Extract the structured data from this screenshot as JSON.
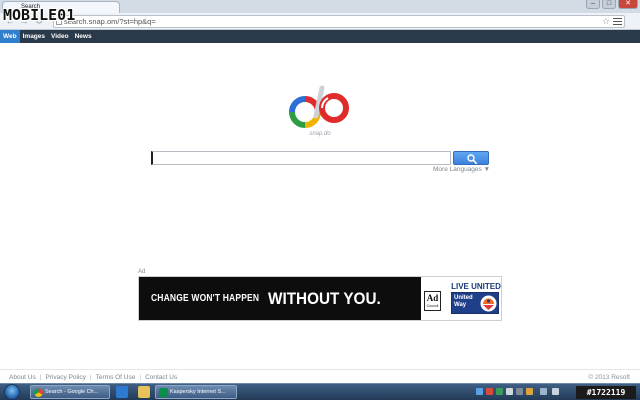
{
  "browser": {
    "tab_title": "Search",
    "url": "search.snap.do/?st=hp&q=",
    "url_host_display": "search.snap.",
    "url_rest_display": "om/?st=hp&q=",
    "window_controls": [
      "–",
      "□",
      "✕"
    ]
  },
  "watermark": {
    "text": "MOBILE01"
  },
  "site_nav": {
    "items": [
      {
        "label": "Web",
        "active": true
      },
      {
        "label": "Images",
        "active": false
      },
      {
        "label": "Video",
        "active": false
      },
      {
        "label": "News",
        "active": false
      }
    ]
  },
  "logo": {
    "caption": "snap.do",
    "colors": {
      "blue": "#2d6fd6",
      "red": "#e02b2b",
      "yellow": "#f0b400",
      "green": "#2e9e45",
      "gray": "#cdd2d8"
    }
  },
  "search": {
    "value": "",
    "placeholder": "",
    "button_icon": "search-icon",
    "more_languages": "More Languages ▼"
  },
  "ad": {
    "label": "Ad",
    "headline_small": "CHANGE WON'T HAPPEN",
    "headline_big": "WITHOUT YOU.",
    "ad_council_mark": "Ad",
    "ad_council_sub": "Council",
    "live_united": "LIVE UNITED",
    "united_way_line1": "United",
    "united_way_line2": "Way"
  },
  "footer": {
    "links": [
      "About Us",
      "Privacy Policy",
      "Terms Of Use",
      "Contact Us"
    ],
    "copyright": "© 2013 Resoft"
  },
  "taskbar": {
    "tasks": [
      {
        "label": "Search - Google Ch...",
        "icon": "chrome-icon"
      },
      {
        "label": "Kaspersky Internet S...",
        "icon": "kaspersky-icon"
      }
    ],
    "id_stamp": "#1722119"
  }
}
